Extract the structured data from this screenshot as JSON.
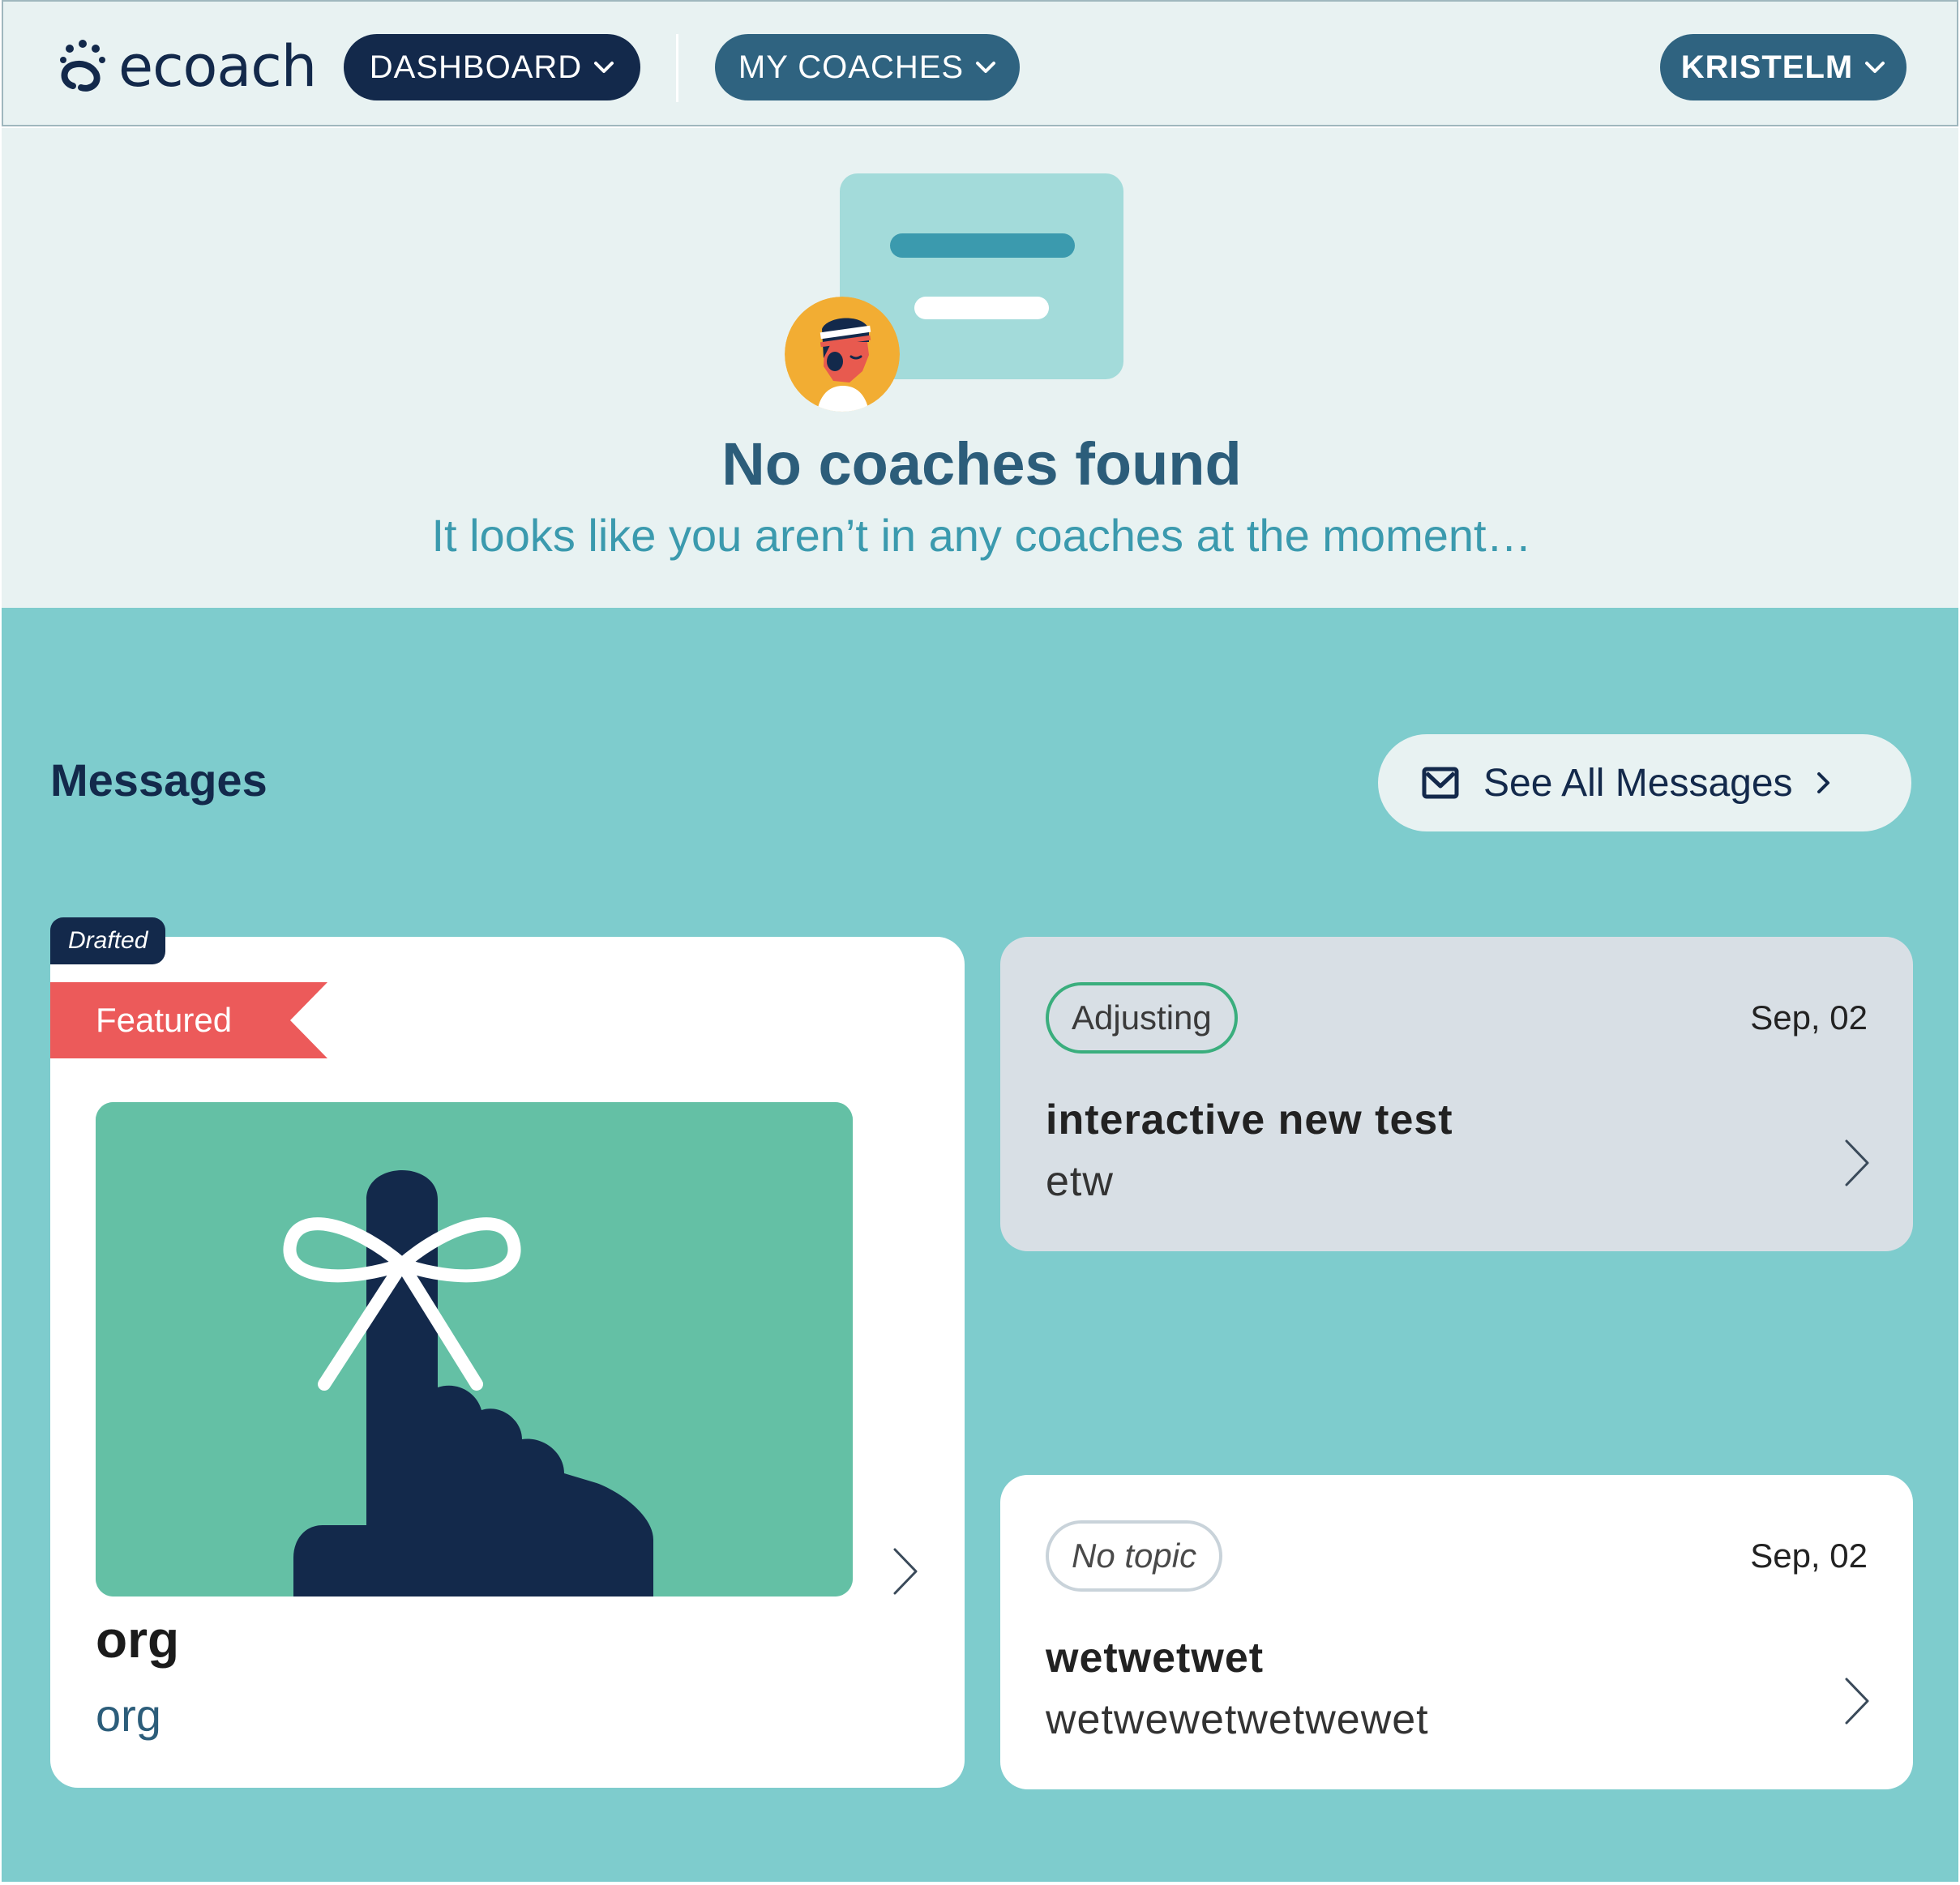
{
  "app": {
    "logo_text": "ecoach"
  },
  "nav": {
    "dashboard_label": "DASHBOARD",
    "coaches_label": "MY COACHES",
    "user_label": "KRISTELM"
  },
  "empty_state": {
    "title": "No coaches found",
    "subtitle": "It looks like you aren’t in any coaches at the moment…"
  },
  "messages": {
    "heading": "Messages",
    "see_all_label": "See All Messages",
    "featured": {
      "status_badge": "Drafted",
      "ribbon": "Featured",
      "title": "org",
      "subtitle": "org"
    },
    "items": [
      {
        "topic": "Adjusting",
        "date": "Sep, 02",
        "title": "interactive new test",
        "body": "etw"
      },
      {
        "topic": "No topic",
        "date": "Sep, 02",
        "title": "wetwetwet",
        "body": "wetwewetwetwewet"
      }
    ]
  },
  "colors": {
    "navy": "#13294b",
    "teal_dark": "#2f6380",
    "teal_section": "#7ecccd",
    "light_bg": "#e8f2f2",
    "featured_red": "#ec5a5a",
    "adjusting_green": "#3aae7d",
    "image_green": "#64c0a5"
  },
  "icons": [
    "logo-icon",
    "chevron-down-icon",
    "mail-icon",
    "chevron-right-icon",
    "ribbon-finger-illustration",
    "avatar-illustration"
  ]
}
